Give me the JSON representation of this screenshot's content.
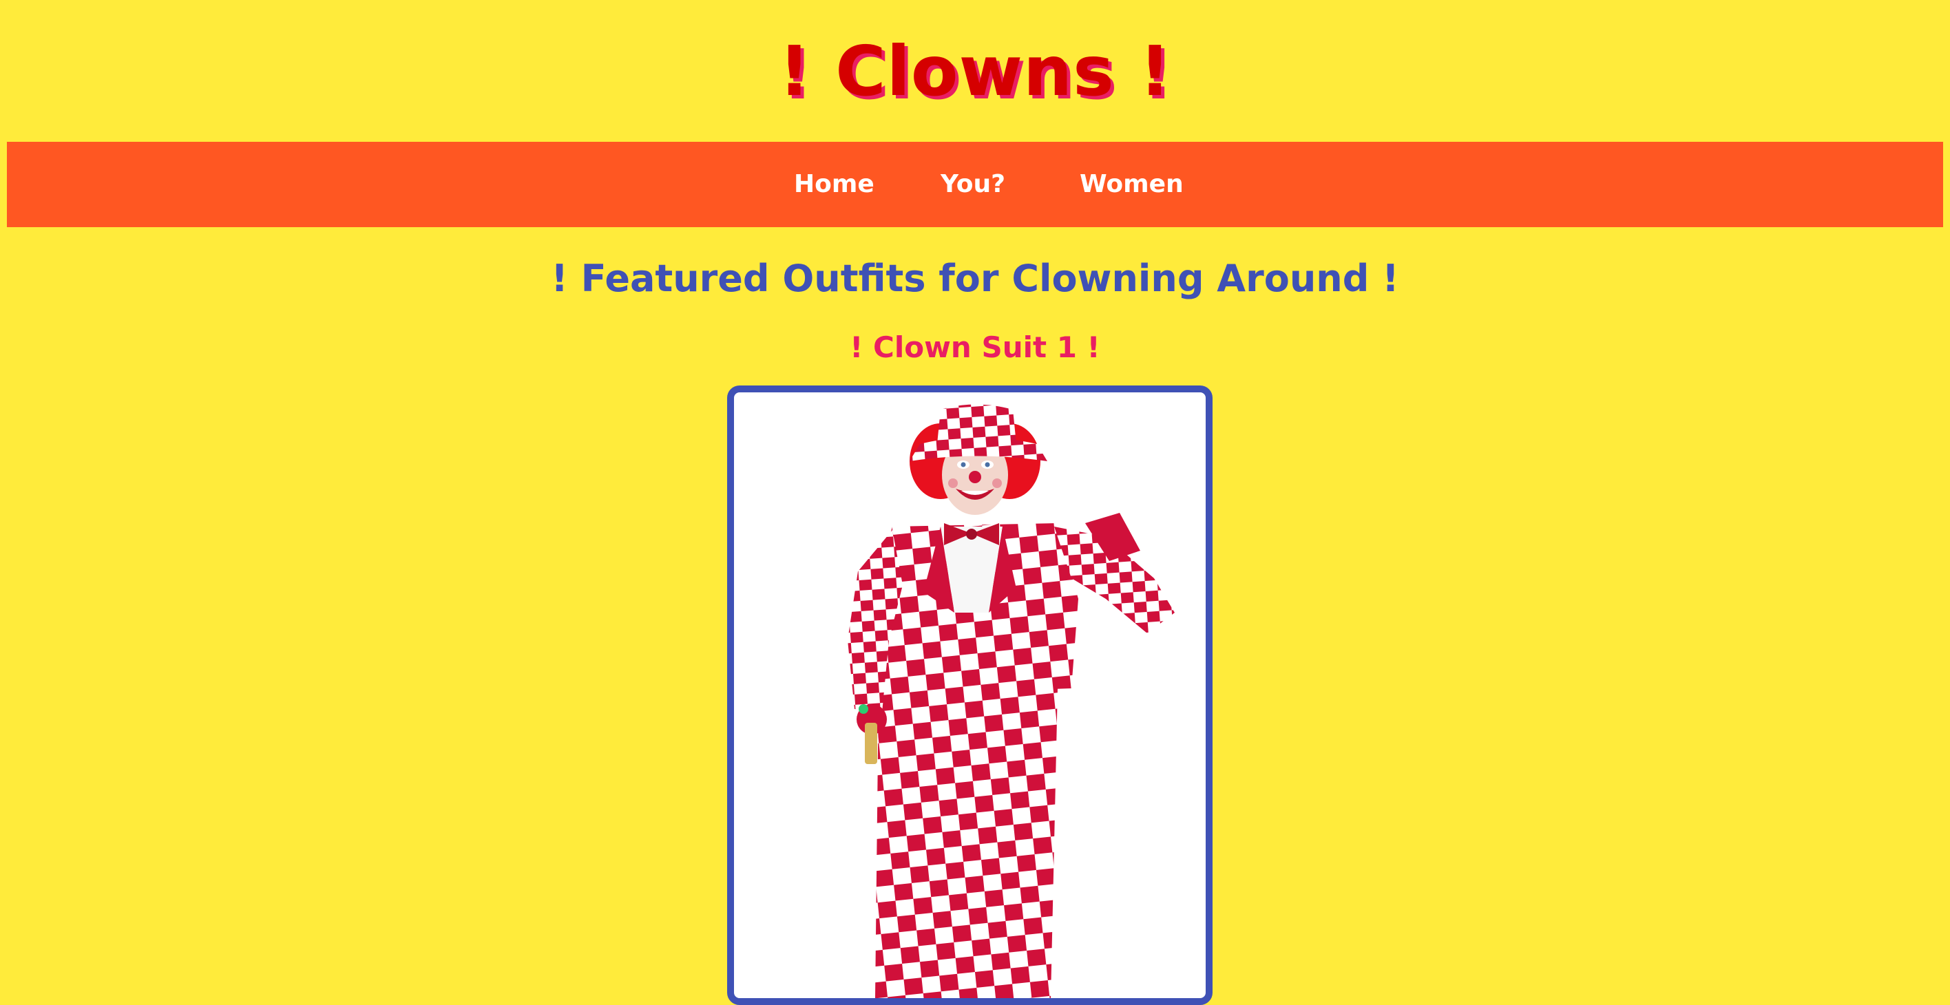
{
  "header": {
    "title": "! Clowns !"
  },
  "nav": {
    "items": [
      {
        "label": "Home"
      },
      {
        "label": "You?"
      },
      {
        "label": "Women"
      }
    ]
  },
  "main": {
    "section_title": "! Featured Outfits for Clowning Around !",
    "outfits": [
      {
        "title": "! Clown Suit 1 !",
        "image": "clown-suit-photo"
      }
    ]
  },
  "colors": {
    "background": "#FFEB3B",
    "title": "#D50000",
    "title_shadow": "#E91E63",
    "nav_background": "#FF5722",
    "nav_text": "#FFFFFF",
    "section_title": "#3F51B5",
    "outfit_title": "#E91E63",
    "card_border": "#3F51B5",
    "suit_red": "#D0103A",
    "suit_white": "#FFFFFF"
  }
}
